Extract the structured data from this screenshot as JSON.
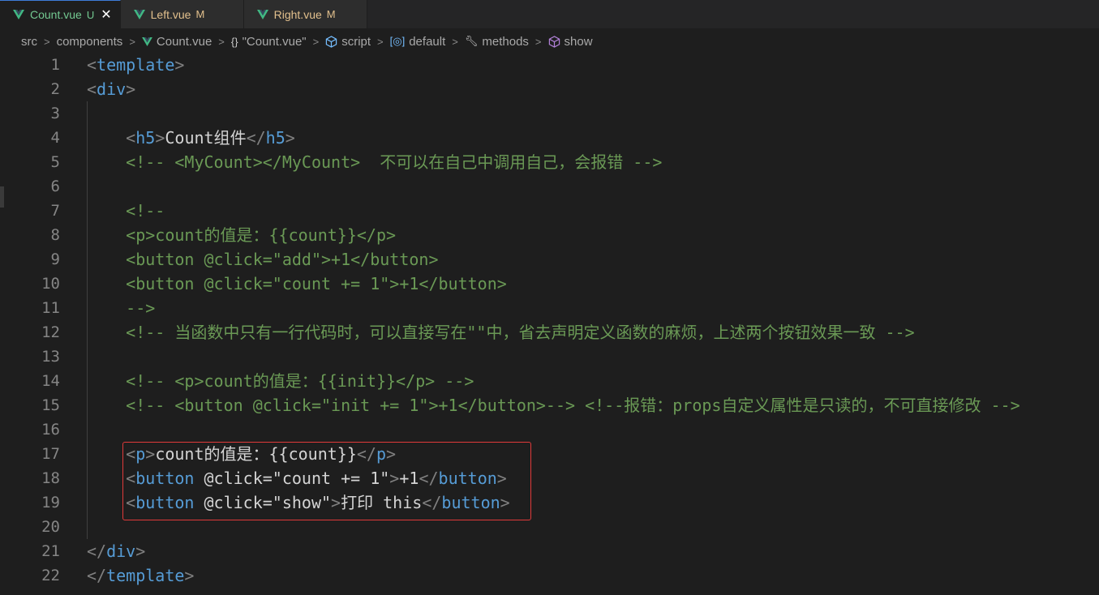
{
  "tabs": [
    {
      "name": "Count.vue",
      "status": "U",
      "active": true
    },
    {
      "name": "Left.vue",
      "status": "M",
      "active": false
    },
    {
      "name": "Right.vue",
      "status": "M",
      "active": false
    }
  ],
  "breadcrumb": [
    "src",
    "components",
    "Count.vue",
    "\"Count.vue\"",
    "script",
    "default",
    "methods",
    "show"
  ],
  "code_lines": [
    {
      "n": "1",
      "indent": "",
      "segs": [
        [
          "br",
          "<"
        ],
        [
          "tag",
          "template"
        ],
        [
          "br",
          ">"
        ]
      ]
    },
    {
      "n": "2",
      "indent": "",
      "segs": [
        [
          "br",
          "<"
        ],
        [
          "tag",
          "div"
        ],
        [
          "br",
          ">"
        ]
      ]
    },
    {
      "n": "3",
      "indent": "",
      "segs": []
    },
    {
      "n": "4",
      "indent": "    ",
      "segs": [
        [
          "br",
          "<"
        ],
        [
          "tag",
          "h5"
        ],
        [
          "br",
          ">"
        ],
        [
          "txt",
          "Count组件"
        ],
        [
          "br",
          "</"
        ],
        [
          "tag",
          "h5"
        ],
        [
          "br",
          ">"
        ]
      ]
    },
    {
      "n": "5",
      "indent": "    ",
      "segs": [
        [
          "cm",
          "<!-- <MyCount></MyCount>  不可以在自己中调用自己，会报错 -->"
        ]
      ]
    },
    {
      "n": "6",
      "indent": "",
      "segs": []
    },
    {
      "n": "7",
      "indent": "    ",
      "segs": [
        [
          "cm",
          "<!--"
        ]
      ]
    },
    {
      "n": "8",
      "indent": "    ",
      "segs": [
        [
          "cm",
          "<p>count的值是：{{count}}</p>"
        ]
      ]
    },
    {
      "n": "9",
      "indent": "    ",
      "segs": [
        [
          "cm",
          "<button @click=\"add\">+1</button>"
        ]
      ]
    },
    {
      "n": "10",
      "indent": "    ",
      "segs": [
        [
          "cm",
          "<button @click=\"count += 1\">+1</button>"
        ]
      ]
    },
    {
      "n": "11",
      "indent": "    ",
      "segs": [
        [
          "cm",
          "-->"
        ]
      ]
    },
    {
      "n": "12",
      "indent": "    ",
      "segs": [
        [
          "cm",
          "<!-- 当函数中只有一行代码时，可以直接写在\"\"中，省去声明定义函数的麻烦，上述两个按钮效果一致 -->"
        ]
      ]
    },
    {
      "n": "13",
      "indent": "",
      "segs": []
    },
    {
      "n": "14",
      "indent": "    ",
      "segs": [
        [
          "cm",
          "<!-- <p>count的值是：{{init}}</p> -->"
        ]
      ]
    },
    {
      "n": "15",
      "indent": "    ",
      "segs": [
        [
          "cm",
          "<!-- <button @click=\"init += 1\">+1</button>--> <!--报错：props自定义属性是只读的，不可直接修改 -->"
        ]
      ]
    },
    {
      "n": "16",
      "indent": "",
      "segs": []
    },
    {
      "n": "17",
      "indent": "    ",
      "segs": [
        [
          "br",
          "<"
        ],
        [
          "tag",
          "p"
        ],
        [
          "br",
          ">"
        ],
        [
          "txt",
          "count的值是：{{count}}"
        ],
        [
          "br",
          "</"
        ],
        [
          "tag",
          "p"
        ],
        [
          "br",
          ">"
        ]
      ]
    },
    {
      "n": "18",
      "indent": "    ",
      "segs": [
        [
          "br",
          "<"
        ],
        [
          "tag",
          "button"
        ],
        [
          "txt",
          " @click="
        ],
        [
          "txt",
          "\"count += 1\""
        ],
        [
          "br",
          ">"
        ],
        [
          "txt",
          "+1"
        ],
        [
          "br",
          "</"
        ],
        [
          "tag",
          "button"
        ],
        [
          "br",
          ">"
        ]
      ]
    },
    {
      "n": "19",
      "indent": "    ",
      "segs": [
        [
          "br",
          "<"
        ],
        [
          "tag",
          "button"
        ],
        [
          "txt",
          " @click="
        ],
        [
          "txt",
          "\"show\""
        ],
        [
          "br",
          ">"
        ],
        [
          "txt",
          "打印 this"
        ],
        [
          "br",
          "</"
        ],
        [
          "tag",
          "button"
        ],
        [
          "br",
          ">"
        ]
      ]
    },
    {
      "n": "20",
      "indent": "",
      "segs": []
    },
    {
      "n": "21",
      "indent": "",
      "segs": [
        [
          "br",
          "</"
        ],
        [
          "tag",
          "div"
        ],
        [
          "br",
          ">"
        ]
      ]
    },
    {
      "n": "22",
      "indent": "",
      "segs": [
        [
          "br",
          "</"
        ],
        [
          "tag",
          "template"
        ],
        [
          "br",
          ">"
        ]
      ]
    }
  ],
  "colors": {
    "comment": "#6a9955",
    "tag": "#569cd6",
    "bracket": "#808080",
    "untracked": "#73c991",
    "modified": "#e2c08d",
    "highlight_border": "#e03a3a"
  }
}
